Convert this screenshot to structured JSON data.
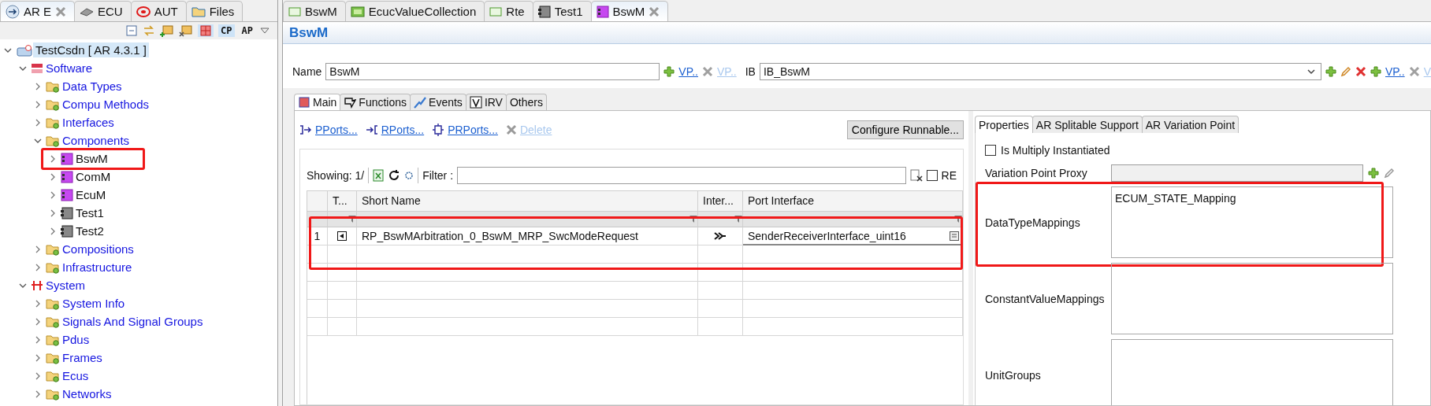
{
  "explorer": {
    "tabs": [
      {
        "label": "AR E",
        "selected": true
      },
      {
        "label": "ECU",
        "selected": false
      },
      {
        "label": "AUT",
        "selected": false
      },
      {
        "label": "Files",
        "selected": false
      }
    ],
    "toolbar": {
      "cp_label": "CP",
      "ap_label": "AP"
    },
    "tree": [
      {
        "label": "TestCsdn [ AR 4.3.1 ]",
        "kind": "project",
        "link": false,
        "expanded": true,
        "selected": true,
        "highlighted": false,
        "children": [
          {
            "label": "Software",
            "kind": "software",
            "link": true,
            "expanded": true,
            "selected": false,
            "highlighted": false,
            "children": [
              {
                "label": "Data Types",
                "kind": "folder",
                "link": true,
                "expanded": false,
                "selected": false,
                "highlighted": false
              },
              {
                "label": "Compu Methods",
                "kind": "folder",
                "link": true,
                "expanded": false,
                "selected": false,
                "highlighted": false
              },
              {
                "label": "Interfaces",
                "kind": "folder",
                "link": true,
                "expanded": false,
                "selected": false,
                "highlighted": false
              },
              {
                "label": "Components",
                "kind": "folder",
                "link": true,
                "expanded": true,
                "selected": false,
                "highlighted": false,
                "children": [
                  {
                    "label": "BswM",
                    "kind": "bsw",
                    "link": false,
                    "expanded": false,
                    "selected": false,
                    "highlighted": true
                  },
                  {
                    "label": "ComM",
                    "kind": "bsw",
                    "link": false,
                    "expanded": false,
                    "selected": false,
                    "highlighted": false
                  },
                  {
                    "label": "EcuM",
                    "kind": "bsw",
                    "link": false,
                    "expanded": false,
                    "selected": false,
                    "highlighted": false
                  },
                  {
                    "label": "Test1",
                    "kind": "swc",
                    "link": false,
                    "expanded": false,
                    "selected": false,
                    "highlighted": false
                  },
                  {
                    "label": "Test2",
                    "kind": "swc",
                    "link": false,
                    "expanded": false,
                    "selected": false,
                    "highlighted": false
                  }
                ]
              },
              {
                "label": "Compositions",
                "kind": "folder",
                "link": true,
                "expanded": false,
                "selected": false,
                "highlighted": false
              },
              {
                "label": "Infrastructure",
                "kind": "folder",
                "link": true,
                "expanded": false,
                "selected": false,
                "highlighted": false
              }
            ]
          },
          {
            "label": "System",
            "kind": "system",
            "link": true,
            "expanded": true,
            "selected": false,
            "highlighted": false,
            "children": [
              {
                "label": "System Info",
                "kind": "folder",
                "link": true,
                "expanded": false,
                "selected": false,
                "highlighted": false
              },
              {
                "label": "Signals And Signal Groups",
                "kind": "folder",
                "link": true,
                "expanded": false,
                "selected": false,
                "highlighted": false
              },
              {
                "label": "Pdus",
                "kind": "folder",
                "link": true,
                "expanded": false,
                "selected": false,
                "highlighted": false
              },
              {
                "label": "Frames",
                "kind": "folder",
                "link": true,
                "expanded": false,
                "selected": false,
                "highlighted": false
              },
              {
                "label": "Ecus",
                "kind": "folder",
                "link": true,
                "expanded": false,
                "selected": false,
                "highlighted": false
              },
              {
                "label": "Networks",
                "kind": "folder",
                "link": true,
                "expanded": false,
                "selected": false,
                "highlighted": false
              }
            ]
          }
        ]
      }
    ]
  },
  "editor": {
    "tabs": [
      {
        "label": "BswM",
        "kind": "plain",
        "selected": false
      },
      {
        "label": "EcucValueCollection",
        "kind": "ecu",
        "selected": false
      },
      {
        "label": "Rte",
        "kind": "plain",
        "selected": false
      },
      {
        "label": "Test1",
        "kind": "swc",
        "selected": false
      },
      {
        "label": "BswM",
        "kind": "bsw",
        "selected": true
      }
    ],
    "title": "BswM",
    "name_label": "Name",
    "name_value": "BswM",
    "vp_add": "VP..",
    "vp_remove": "VP..",
    "ib_label": "IB",
    "ib_value": "IB_BswM",
    "ib_vp_add": "VP..",
    "ib_vp_remove": "V",
    "main_tabs": [
      {
        "label": "Main",
        "selected": true
      },
      {
        "label": "Functions",
        "selected": false
      },
      {
        "label": "Events",
        "selected": false
      },
      {
        "label": "IRV",
        "selected": false
      },
      {
        "label": "Others",
        "selected": false
      }
    ],
    "ports": {
      "actions": [
        {
          "label": "PPorts...",
          "disabled": false
        },
        {
          "label": "RPorts...",
          "disabled": false
        },
        {
          "label": "PRPorts...",
          "disabled": false
        },
        {
          "label": "Delete",
          "disabled": true
        }
      ],
      "configure_button": "Configure Runnable...",
      "showing": "Showing: 1/",
      "filter_label": "Filter :",
      "re_label": "RE",
      "re_checked": false,
      "table": {
        "highlighted": true,
        "columns": [
          "T...",
          "Short Name",
          "Inter...",
          "Port Interface"
        ],
        "rows": [
          {
            "number": "1",
            "short_name": "RP_BswMArbitration_0_BswM_MRP_SwcModeRequest",
            "port_interface": "SenderReceiverInterface_uint16"
          }
        ]
      }
    },
    "properties": {
      "tabs": [
        {
          "label": "Properties",
          "selected": true
        },
        {
          "label": "AR Splitable Support",
          "selected": false
        },
        {
          "label": "AR Variation Point",
          "selected": false
        }
      ],
      "multiply_instantiated": {
        "label": "Is Multiply Instantiated",
        "checked": false
      },
      "fields": [
        {
          "kind": "single",
          "label": "Variation Point Proxy",
          "disabled": true,
          "highlighted": false
        },
        {
          "kind": "list",
          "label": "DataTypeMappings",
          "items": [
            "ECUM_STATE_Mapping"
          ],
          "highlighted": true
        },
        {
          "kind": "list",
          "label": "ConstantValueMappings",
          "highlighted": false
        },
        {
          "kind": "list",
          "label": "UnitGroups",
          "highlighted": false
        }
      ]
    }
  }
}
